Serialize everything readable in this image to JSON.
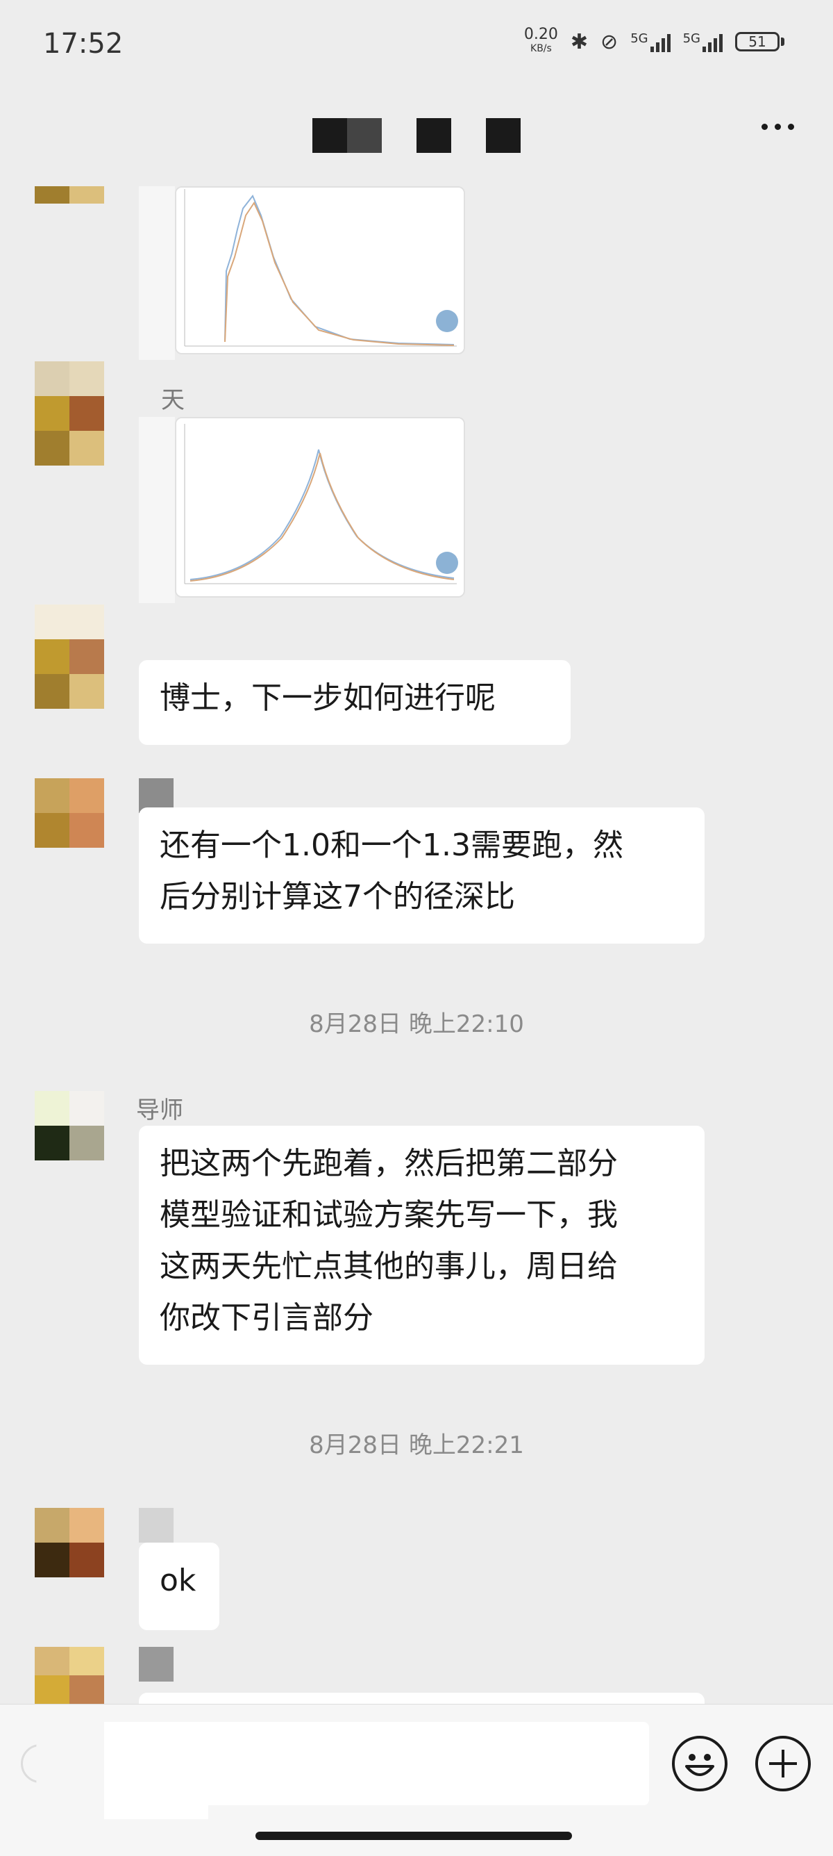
{
  "status_bar": {
    "time": "17:52",
    "net_speed_value": "0.20",
    "net_speed_unit": "KB/s",
    "signal_1_label": "5G",
    "signal_2_label": "5G",
    "battery": "51"
  },
  "messages": {
    "image_2_sender": "天",
    "text_1": "博士，下一步如何进行呢",
    "text_2_line1": "还有一个1.0和一个1.3需要跑，然",
    "text_2_line2": "后分别计算这7个的径深比",
    "time_1": "8月28日 晚上22:10",
    "advisor_name": "导师",
    "text_3_line1": "把这两个先跑着，然后把第二部分",
    "text_3_line2": "模型验证和试验方案先写一下，我",
    "text_3_line3": "这两天先忙点其他的事儿，周日给",
    "text_3_line4": "你改下引言部分",
    "time_2": "8月28日 晚上22:21",
    "text_4": "ok"
  },
  "icons": {
    "more": "more-dots-icon",
    "emoji": "emoji-icon",
    "plus": "plus-icon"
  },
  "colors": {
    "chat_bg": "#ededed",
    "bubble_bg": "#ffffff",
    "time_text": "#8a8a8a"
  }
}
